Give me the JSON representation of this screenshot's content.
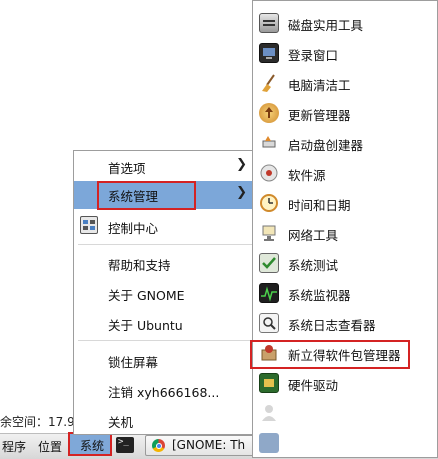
{
  "desktop": {
    "status_text": "余空间：17.9"
  },
  "panel": {
    "programs_label": "程序",
    "places_label": "位置",
    "system_label": "系统",
    "task_label": "[GNOME: Th"
  },
  "system_menu": {
    "items": [
      {
        "label": "首选项",
        "submenu": true
      },
      {
        "label": "系统管理",
        "submenu": true,
        "highlighted": true
      },
      {
        "label": "控制中心",
        "icon": "control-center-icon"
      },
      {
        "label": "帮助和支持"
      },
      {
        "label": "关于 GNOME"
      },
      {
        "label": "关于 Ubuntu"
      },
      {
        "label": "锁住屏幕"
      },
      {
        "label": "注销 xyh666168..."
      },
      {
        "label": "关机"
      }
    ]
  },
  "admin_submenu": {
    "items": [
      {
        "label": "磁盘实用工具",
        "icon": "disk-utility-icon"
      },
      {
        "label": "登录窗口",
        "icon": "login-window-icon"
      },
      {
        "label": "电脑清洁工",
        "icon": "computer-janitor-icon"
      },
      {
        "label": "更新管理器",
        "icon": "update-manager-icon"
      },
      {
        "label": "启动盘创建器",
        "icon": "startup-disk-creator-icon"
      },
      {
        "label": "软件源",
        "icon": "software-sources-icon"
      },
      {
        "label": "时间和日期",
        "icon": "time-and-date-icon"
      },
      {
        "label": "网络工具",
        "icon": "network-tools-icon"
      },
      {
        "label": "系统测试",
        "icon": "system-testing-icon"
      },
      {
        "label": "系统监视器",
        "icon": "system-monitor-icon"
      },
      {
        "label": "系统日志查看器",
        "icon": "log-viewer-icon"
      },
      {
        "label": "新立得软件包管理器",
        "icon": "synaptic-package-manager-icon",
        "highlighted": true
      },
      {
        "label": "硬件驱动",
        "icon": "hardware-drivers-icon"
      }
    ]
  },
  "colors": {
    "highlight": "#7ca7d9",
    "annotation_red": "#d42323",
    "desktop_pink": "#f4c9f0"
  }
}
